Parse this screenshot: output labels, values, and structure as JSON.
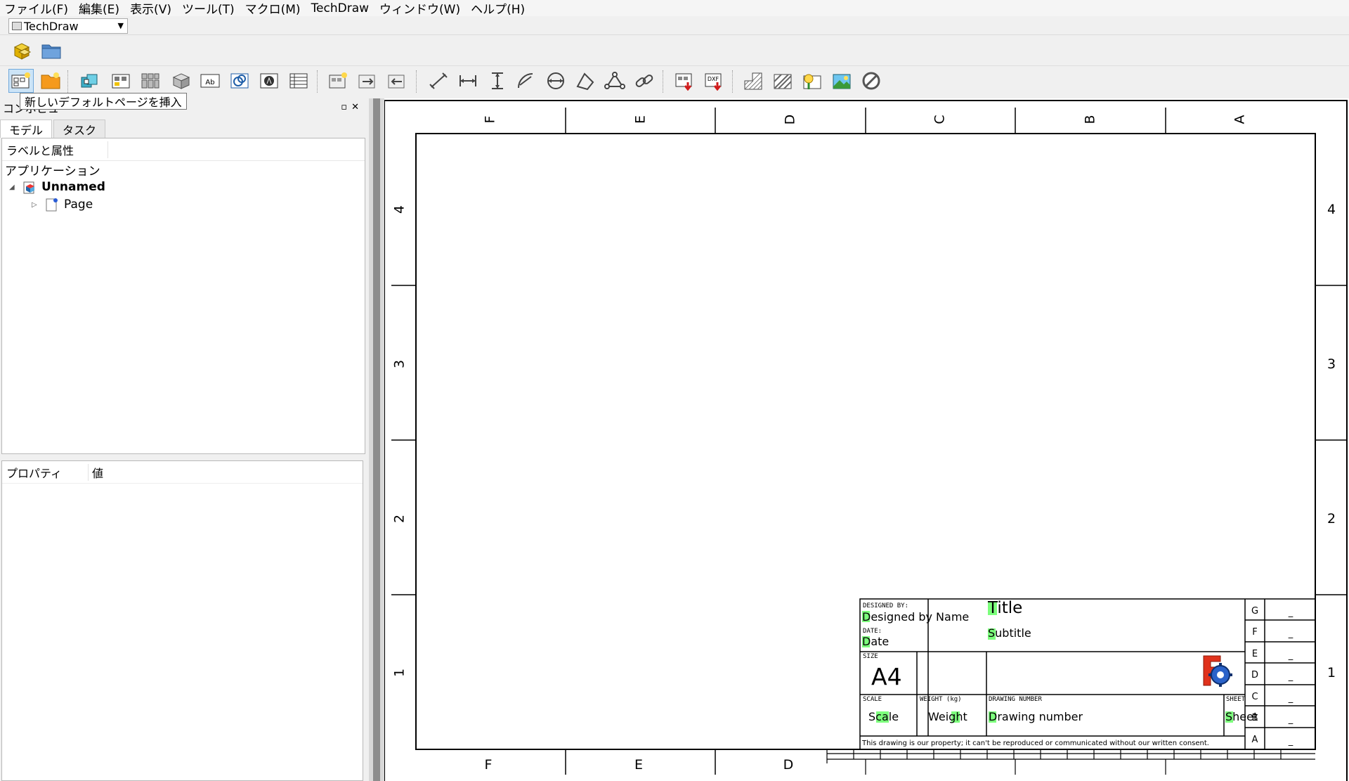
{
  "menu": [
    "ファイル(F)",
    "編集(E)",
    "表示(V)",
    "ツール(T)",
    "マクロ(M)",
    "TechDraw",
    "ウィンドウ(W)",
    "ヘルプ(H)"
  ],
  "workbench": {
    "selected": "TechDraw"
  },
  "toolbar_file": [
    "part-cubes-icon",
    "open-folder-icon"
  ],
  "toolbar_techdraw": [
    "insert-default-page-icon",
    "insert-template-page-icon",
    "insert-view-icon",
    "insert-active-view-icon",
    "insert-projection-group-icon",
    "insert-section-view-icon",
    "insert-annotation-icon",
    "insert-arch-view-icon",
    "insert-draft-view-icon",
    "insert-spreadsheet-view-icon",
    "insert-clip-group-icon",
    "clip-add-icon",
    "clip-remove-icon",
    "length-dimension-icon",
    "horizontal-dimension-icon",
    "vertical-dimension-icon",
    "radius-dimension-icon",
    "diameter-dimension-icon",
    "angle-dimension-icon",
    "three-point-angle-icon",
    "link-dimension-icon",
    "export-svg-icon",
    "export-dxf-icon",
    "hatch-icon",
    "geom-hatch-icon",
    "insert-image-icon",
    "insert-symbol-icon",
    "toggle-frame-icon"
  ],
  "tooltip": "新しいデフォルトページを挿入",
  "combo": {
    "title": "コンボビュー",
    "tabs": [
      "モデル",
      "タスク"
    ],
    "tree_header": "ラベルと属性",
    "app_label": "アプリケーション",
    "document": "Unnamed",
    "page": "Page",
    "props_headers": [
      "プロパティ",
      "値"
    ]
  },
  "drawing": {
    "top_cols": [
      "F",
      "E",
      "D",
      "C",
      "B",
      "A"
    ],
    "bottom_cols": [
      "F",
      "E",
      "D"
    ],
    "rows": [
      "4",
      "3",
      "2",
      "1"
    ],
    "titleblock": {
      "designed_by_label": "DESIGNED BY:",
      "designed_by": "Designed by Name",
      "date_label": "DATE:",
      "date": "Date",
      "title": "Title",
      "subtitle": "Subtitle",
      "size_label": "SIZE",
      "size": "A4",
      "scale_label": "SCALE",
      "scale": "Scale",
      "weight_label": "WEIGHT (kg)",
      "weight": "Weight",
      "drawing_number_label": "DRAWING NUMBER",
      "drawing_number": "Drawing number",
      "sheet_label": "SHEET",
      "sheet": "Sheet",
      "revisions": [
        "G",
        "F",
        "E",
        "D",
        "C",
        "B",
        "A"
      ],
      "revision_value": "_",
      "notice": "This drawing is our property; it can't be reproduced or communicated without our written consent."
    }
  }
}
